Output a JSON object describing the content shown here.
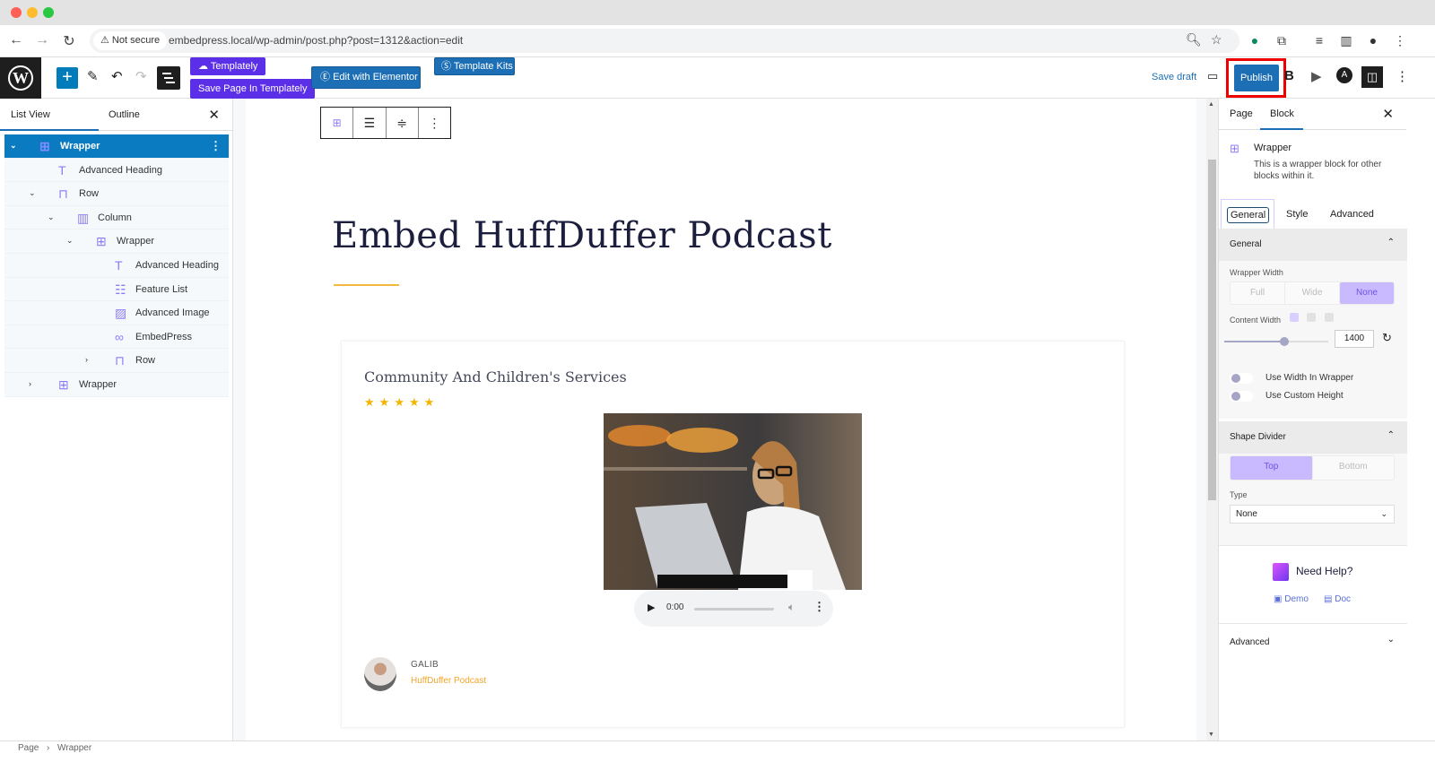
{
  "browser": {
    "security_label": "Not secure",
    "url": "embedpress.local/wp-admin/post.php?post=1312&action=edit",
    "icons": [
      "back-icon",
      "forward-icon",
      "reload-icon",
      "zoom-icon",
      "bookmark-star-icon",
      "grammarly-icon",
      "extensions-icon",
      "media-icon",
      "sidepanel-icon",
      "profile-avatar",
      "menu-kebab-icon"
    ]
  },
  "toolbar": {
    "templately_label": "Templately",
    "save_templately_label": "Save Page In Templately",
    "elementor_label": "Edit with Elementor",
    "template_kits_label": "Template Kits",
    "save_draft_label": "Save draft",
    "publish_label": "Publish",
    "highlight_color": "#e00000",
    "accent_color": "#1d6fb5"
  },
  "list_view": {
    "tabs": [
      "List View",
      "Outline"
    ],
    "active_tab": "List View",
    "items": [
      {
        "label": "Wrapper",
        "level": 0,
        "expanded": true,
        "selected": true,
        "icon": "wrapper-icon"
      },
      {
        "label": "Advanced Heading",
        "level": 1,
        "icon": "heading-icon"
      },
      {
        "label": "Row",
        "level": 1,
        "expanded": true,
        "icon": "row-icon"
      },
      {
        "label": "Column",
        "level": 2,
        "expanded": true,
        "icon": "column-icon"
      },
      {
        "label": "Wrapper",
        "level": 3,
        "expanded": true,
        "icon": "wrapper-icon"
      },
      {
        "label": "Advanced Heading",
        "level": 4,
        "icon": "heading-icon"
      },
      {
        "label": "Feature List",
        "level": 4,
        "icon": "feature-list-icon"
      },
      {
        "label": "Advanced Image",
        "level": 4,
        "icon": "image-icon"
      },
      {
        "label": "EmbedPress",
        "level": 4,
        "icon": "embedpress-icon"
      },
      {
        "label": "Row",
        "level": 4,
        "expanded": false,
        "icon": "row-icon"
      },
      {
        "label": "Wrapper",
        "level": 1,
        "expanded": false,
        "icon": "wrapper-icon"
      }
    ]
  },
  "canvas": {
    "page_title": "Embed HuffDuffer Podcast",
    "card": {
      "title": "Community And Children's Services",
      "rating": 5,
      "rating_max": 5,
      "audio_time": "0:00",
      "author_name": "GALIB",
      "author_subtitle": "HuffDuffer Podcast"
    }
  },
  "settings": {
    "tabs": [
      "Page",
      "Block"
    ],
    "active_tab": "Block",
    "block_name": "Wrapper",
    "block_description": "This is a wrapper block for other blocks within it.",
    "sub_tabs": [
      "General",
      "Style",
      "Advanced"
    ],
    "active_sub_tab": "General",
    "general_section": {
      "title": "General",
      "wrapper_width_label": "Wrapper Width",
      "wrapper_width_options": [
        "Full",
        "Wide",
        "None"
      ],
      "wrapper_width_selected": "None",
      "content_width_label": "Content Width",
      "content_width_value": "1400",
      "content_width_slider_fraction": 0.58,
      "toggle_width_label": "Use Width In Wrapper",
      "toggle_width_on": false,
      "toggle_height_label": "Use Custom Height",
      "toggle_height_on": false
    },
    "shape_divider": {
      "title": "Shape Divider",
      "options": [
        "Top",
        "Bottom"
      ],
      "selected": "Top",
      "type_label": "Type",
      "type_value": "None"
    },
    "help": {
      "title": "Need Help?",
      "demo_label": "Demo",
      "doc_label": "Doc"
    },
    "advanced_label": "Advanced"
  },
  "breadcrumb": [
    "Page",
    "Wrapper"
  ]
}
